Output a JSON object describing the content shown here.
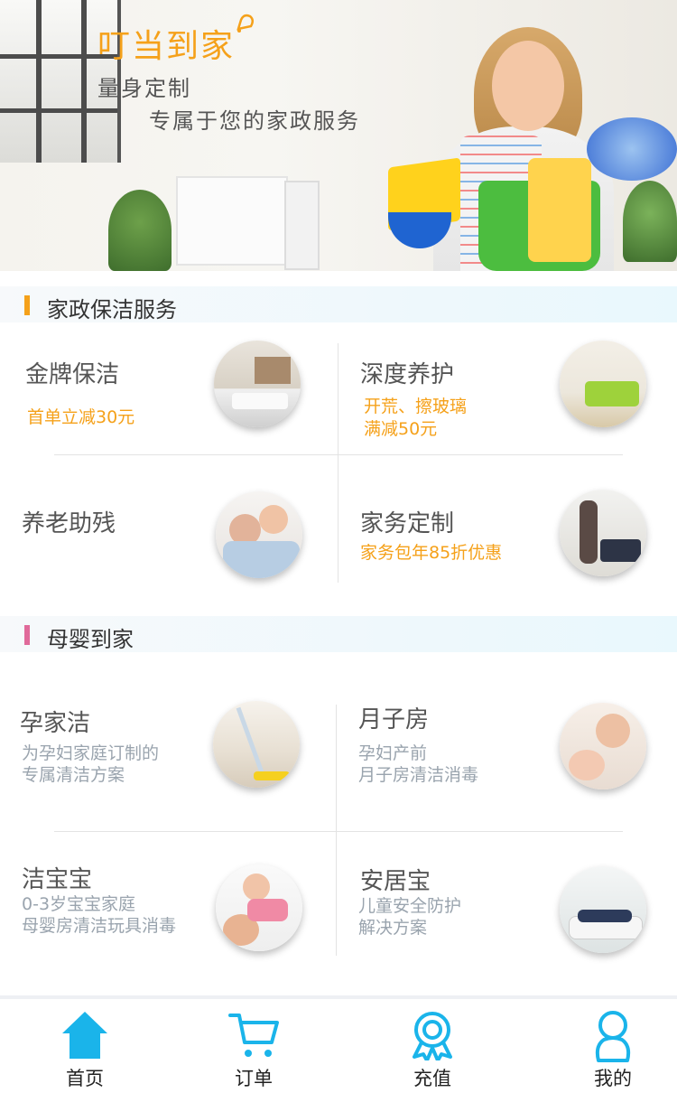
{
  "banner": {
    "brand": "叮当到家",
    "slogan_line1": "量身定制",
    "slogan_line2": "专属于您的家政服务"
  },
  "sections": [
    {
      "title": "家政保洁服务",
      "mark_color": "#f5a11a",
      "items": [
        {
          "name": "金牌保洁",
          "promo": [
            "首单立减30元"
          ],
          "image": "living-room-photo"
        },
        {
          "name": "深度养护",
          "promo": [
            "开荒、擦玻璃",
            "满减50元"
          ],
          "image": "green-sofa-photo"
        },
        {
          "name": "养老助残",
          "promo": [],
          "image": "elder-care-photo"
        },
        {
          "name": "家务定制",
          "promo": [
            "家务包年85折优惠"
          ],
          "image": "housekeeper-photo"
        }
      ]
    },
    {
      "title": "母婴到家",
      "mark_color": "#e06a9a",
      "items": [
        {
          "name": "孕家洁",
          "desc": [
            "为孕妇家庭订制的",
            "专属清洁方案"
          ],
          "image": "mop-photo"
        },
        {
          "name": "月子房",
          "desc": [
            "孕妇产前",
            "月子房清洁消毒"
          ],
          "image": "mother-baby-photo"
        },
        {
          "name": "洁宝宝",
          "desc": [
            "0-3岁宝宝家庭",
            "母婴房清洁玩具消毒"
          ],
          "image": "baby-play-photo"
        },
        {
          "name": "安居宝",
          "desc": [
            "儿童安全防护",
            "解决方案"
          ],
          "image": "sofa-child-photo"
        }
      ]
    }
  ],
  "tabbar": {
    "accent": "#1ab4ea",
    "tabs": [
      {
        "label": "首页",
        "icon": "home-icon",
        "active": true
      },
      {
        "label": "订单",
        "icon": "cart-icon",
        "active": false
      },
      {
        "label": "充值",
        "icon": "badge-icon",
        "active": false
      },
      {
        "label": "我的",
        "icon": "user-icon",
        "active": false
      }
    ]
  }
}
